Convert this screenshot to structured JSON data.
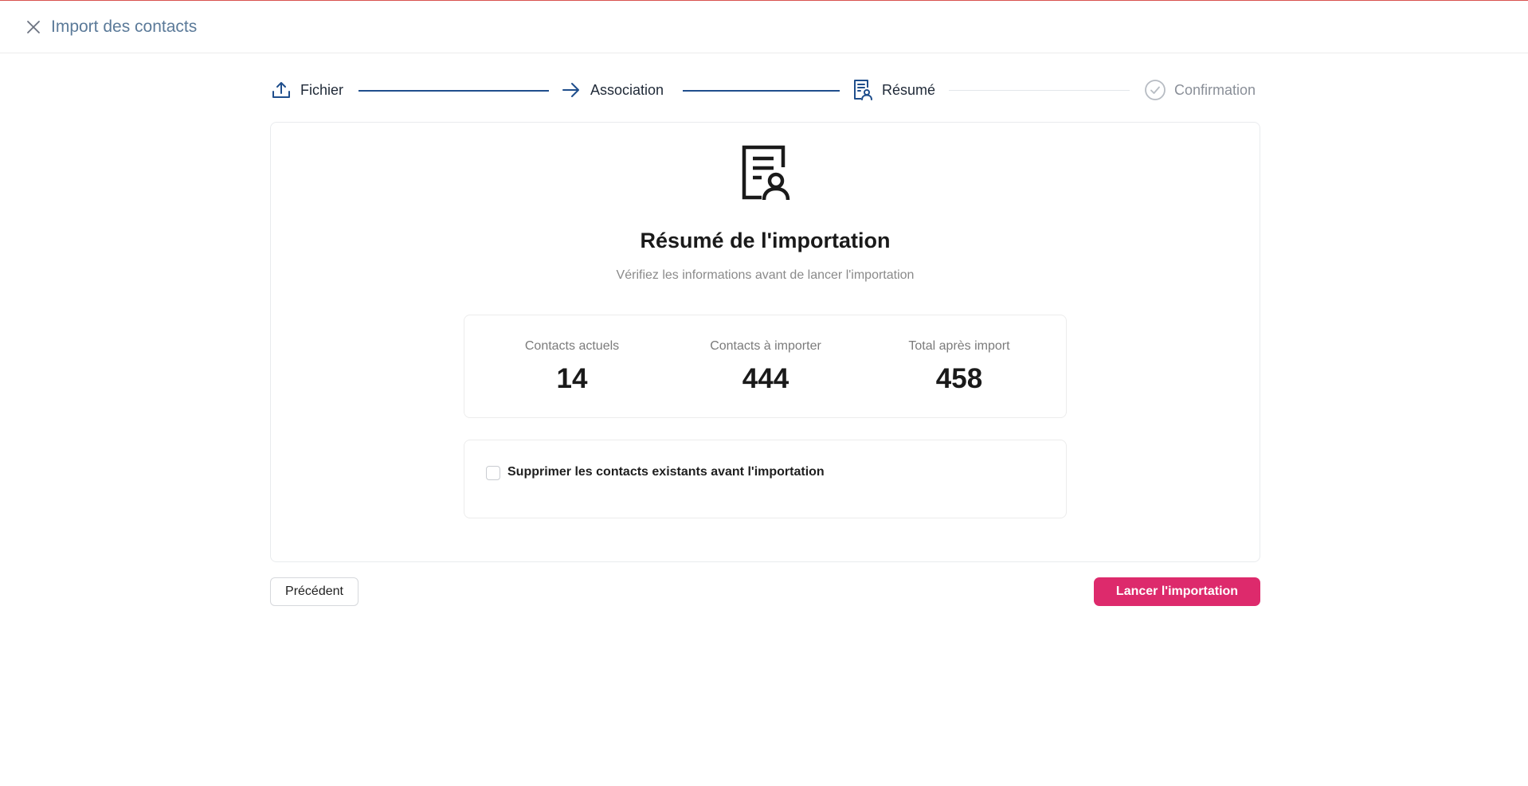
{
  "header": {
    "title": "Import des contacts",
    "close_icon": "close-icon"
  },
  "stepper": {
    "steps": [
      {
        "label": "Fichier",
        "icon": "upload-icon",
        "state": "done"
      },
      {
        "label": "Association",
        "icon": "arrow-right-icon",
        "state": "done"
      },
      {
        "label": "Résumé",
        "icon": "document-user-icon",
        "state": "active"
      },
      {
        "label": "Confirmation",
        "icon": "check-circle-icon",
        "state": "pending"
      }
    ],
    "colors": {
      "done": "#1f4e8c",
      "pending": "#e3e6ea"
    }
  },
  "summary": {
    "icon": "document-user-icon",
    "title": "Résumé de l'importation",
    "subtitle": "Vérifiez les informations avant de lancer l'importation",
    "stats": [
      {
        "label": "Contacts actuels",
        "value": "14"
      },
      {
        "label": "Contacts à importer",
        "value": "444"
      },
      {
        "label": "Total après import",
        "value": "458"
      }
    ],
    "option": {
      "label": "Supprimer les contacts existants avant l'importation",
      "checked": false
    }
  },
  "footer": {
    "previous_label": "Précédent",
    "launch_label": "Lancer l'importation",
    "launch_color": "#dd2a6c"
  }
}
